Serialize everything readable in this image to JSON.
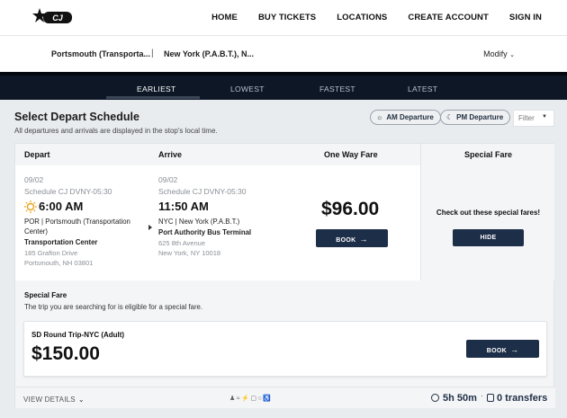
{
  "header": {
    "nav": [
      "HOME",
      "BUY TICKETS",
      "LOCATIONS",
      "CREATE ACCOUNT",
      "SIGN IN"
    ]
  },
  "trip": {
    "from": "Portsmouth (Transporta...",
    "separator": "|",
    "to": "New York (P.A.B.T.), N...",
    "modify": "Modify"
  },
  "sort_tabs": [
    "EARLIEST",
    "LOWEST",
    "FASTEST",
    "LATEST"
  ],
  "active_sort": "EARLIEST",
  "schedule": {
    "title": "Select Depart Schedule",
    "subtitle": "All departures and arrivals are displayed in the stop's local time.",
    "am_label": "AM Departure",
    "pm_label": "PM Departure",
    "filter_label": "Filter"
  },
  "columns": {
    "depart": "Depart",
    "arrive": "Arrive",
    "one_way": "One Way Fare",
    "special": "Special Fare"
  },
  "trip_row": {
    "depart_date": "09/02",
    "depart_schedule": "Schedule CJ DVNY-05:30",
    "depart_time": "6:00 AM",
    "depart_stop_line1": "POR | Portsmouth (Transportation",
    "depart_stop_line2": "Center)",
    "depart_stop_name": "Transportation Center",
    "depart_addr1": "185 Grafton Drive",
    "depart_addr2": "Portsmouth, NH 03801",
    "arrive_date": "09/02",
    "arrive_schedule": "Schedule CJ DVNY-05:30",
    "arrive_time": "11:50 AM",
    "arrive_stop_line1": "NYC | New York (P.A.B.T.)",
    "arrive_stop_name": "Port Authority Bus Terminal",
    "arrive_addr1": "625 8th Avenue",
    "arrive_addr2": "New York, NY 10018",
    "price": "$96.00",
    "book_label": "BOOK",
    "special_msg": "Check out these special fares!",
    "hide_label": "HIDE"
  },
  "special_fare": {
    "title": "Special Fare",
    "subtitle": "The trip you are searching for is eligible for a special fare.",
    "name": "SD Round Trip-NYC (Adult)",
    "price": "$150.00",
    "book_label": "BOOK"
  },
  "footer": {
    "view_details": "VIEW DETAILS",
    "duration": "5h 50m",
    "transfers": "0 transfers"
  },
  "colors": {
    "navy": "#0d1726",
    "button": "#1d2e48",
    "sun": "#e8a317"
  }
}
